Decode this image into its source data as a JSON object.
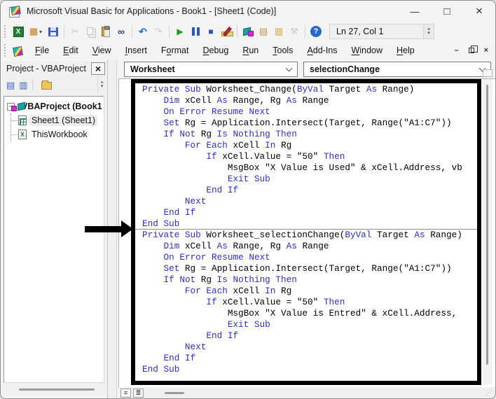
{
  "window": {
    "title": "Microsoft Visual Basic for Applications - Book1 - [Sheet1 (Code)]"
  },
  "icons": {
    "minimize": "—",
    "maximize": "□",
    "close": "×",
    "mdi_minimize": "–",
    "mdi_close": "×",
    "view_object": "▦",
    "dropdown": "▾",
    "cut": "✂",
    "find": "∞",
    "undo": "↶",
    "redo": "↷",
    "run": "▶",
    "reset": "■",
    "properties": "▤",
    "object_browser": "▥",
    "tools": "⚒",
    "help": "?",
    "excel_x": "X",
    "view_code_small": "▤",
    "view_object_small": "▥",
    "procedure_view": "≡",
    "module_view": "≣",
    "lines": "≡",
    "grip": "⋰",
    "tree_collapse": "−"
  },
  "menubar": {
    "menus": [
      {
        "label": "File",
        "u": 0
      },
      {
        "label": "Edit",
        "u": 0
      },
      {
        "label": "View",
        "u": 0
      },
      {
        "label": "Insert",
        "u": 0
      },
      {
        "label": "Format",
        "u": 1
      },
      {
        "label": "Debug",
        "u": 0
      },
      {
        "label": "Run",
        "u": 0
      },
      {
        "label": "Tools",
        "u": 0
      },
      {
        "label": "Add-Ins",
        "u": 0
      },
      {
        "label": "Window",
        "u": 0
      },
      {
        "label": "Help",
        "u": 0
      }
    ]
  },
  "toolbar": {
    "status": "Ln 27, Col 1"
  },
  "combos": {
    "object_box": "Worksheet",
    "procedure_box": "selectionChange"
  },
  "project_panel": {
    "title": "Project - VBAProject",
    "tree": [
      {
        "label": "VBAProject (Book1"
      },
      {
        "label": "Sheet1 (Sheet1)"
      },
      {
        "label": "ThisWorkbook"
      }
    ]
  },
  "code": {
    "keywords": [
      "Private",
      "Sub",
      "ByVal",
      "As",
      "Dim",
      "On",
      "Error",
      "Resume",
      "Next",
      "Set",
      "If",
      "Not",
      "Is",
      "Nothing",
      "Then",
      "For",
      "Each",
      "In",
      "Exit",
      "End"
    ],
    "lines": [
      {
        "text": "Private Sub Worksheet_Change(ByVal Target As Range)"
      },
      {
        "text": "    Dim xCell As Range, Rg As Range"
      },
      {
        "text": "    On Error Resume Next"
      },
      {
        "text": "    Set Rg = Application.Intersect(Target, Range(\"A1:C7\"))"
      },
      {
        "text": "    If Not Rg Is Nothing Then"
      },
      {
        "text": "        For Each xCell In Rg"
      },
      {
        "text": "            If xCell.Value = \"50\" Then"
      },
      {
        "text": "                MsgBox \"X Value is Used\" & xCell.Address, vb"
      },
      {
        "text": "                Exit Sub"
      },
      {
        "text": "            End If"
      },
      {
        "text": "        Next"
      },
      {
        "text": "    End If"
      },
      {
        "text": "End Sub"
      },
      {
        "text": "Private Sub Worksheet_selectionChange(ByVal Target As Range)",
        "separator_before": true
      },
      {
        "text": "    Dim xCell As Range, Rg As Range"
      },
      {
        "text": "    On Error Resume Next"
      },
      {
        "text": "    Set Rg = Application.Intersect(Target, Range(\"A1:C7\"))"
      },
      {
        "text": "    If Not Rg Is Nothing Then"
      },
      {
        "text": "        For Each xCell In Rg"
      },
      {
        "text": "            If xCell.Value = \"50\" Then"
      },
      {
        "text": "                MsgBox \"X Value is Entred\" & xCell.Address,"
      },
      {
        "text": "                Exit Sub"
      },
      {
        "text": "            End If"
      },
      {
        "text": "        Next"
      },
      {
        "text": "    End If"
      },
      {
        "text": "End Sub"
      }
    ]
  },
  "colors": {
    "keyword": "#2d2dc9",
    "text": "#000000",
    "annotation": "#000000"
  }
}
